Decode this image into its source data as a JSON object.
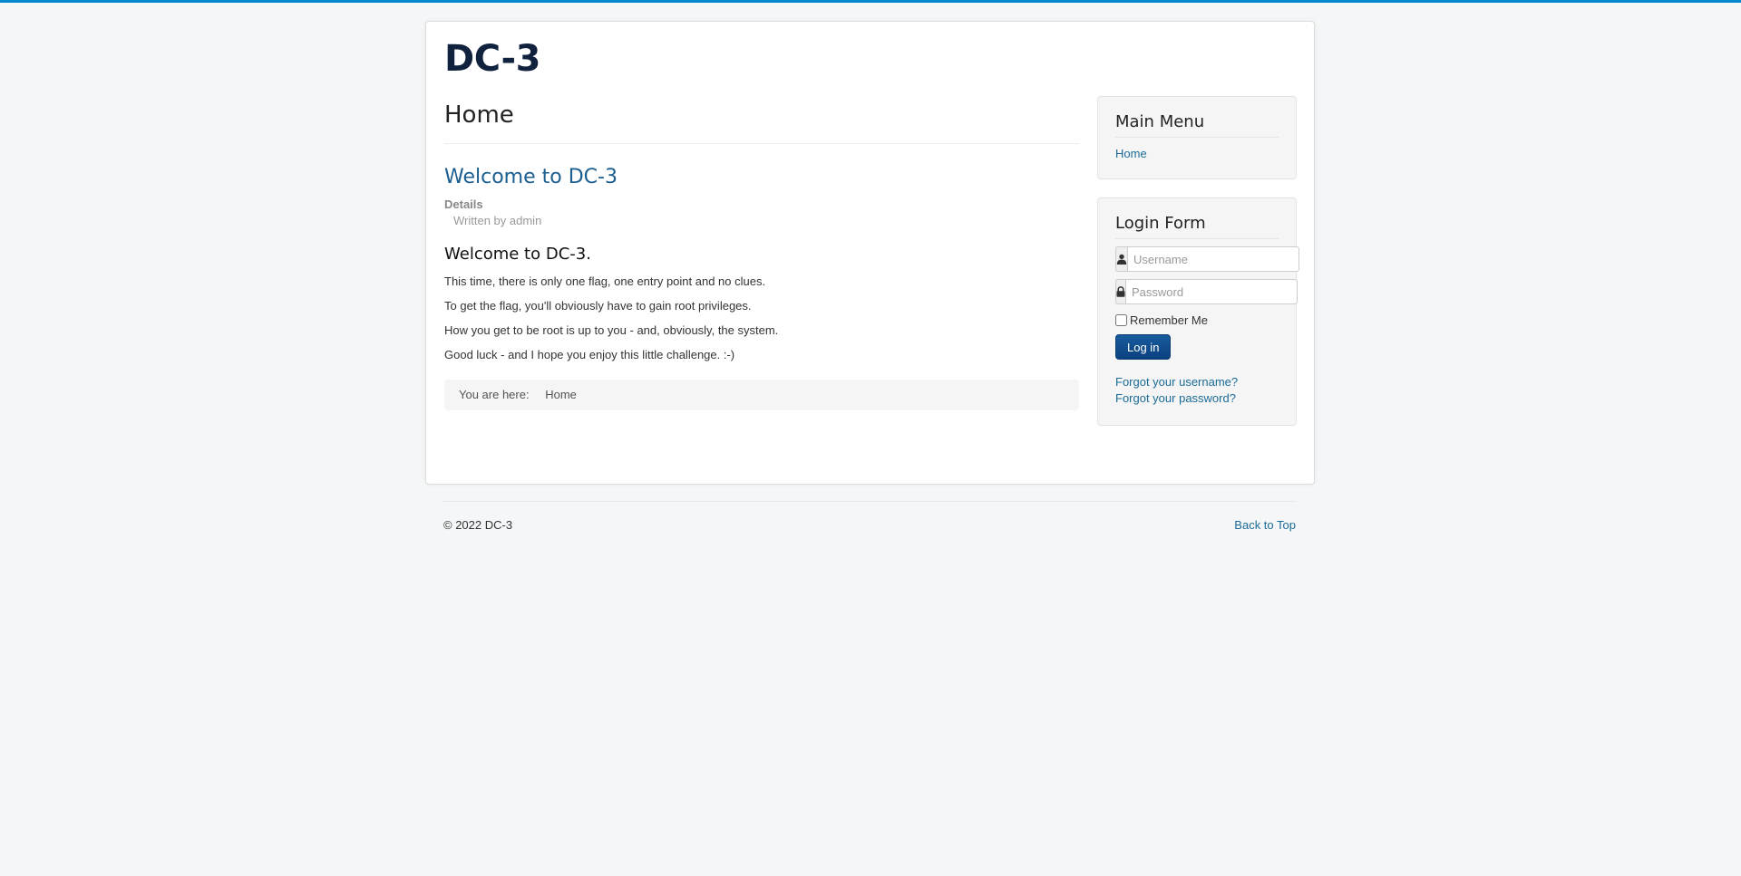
{
  "site": {
    "brand": "DC-3"
  },
  "page": {
    "title": "Home"
  },
  "article": {
    "title": "Welcome to DC-3",
    "details_label": "Details",
    "written_by": "Written by admin",
    "heading": "Welcome to DC-3.",
    "paragraphs": [
      "This time, there is only one flag, one entry point and no clues.",
      "To get the flag, you'll obviously have to gain root privileges.",
      "How you get to be root is up to you - and, obviously, the system.",
      "Good luck - and I hope you enjoy this little challenge.  :-)"
    ]
  },
  "breadcrumb": {
    "prefix": "You are here:",
    "current": "Home"
  },
  "main_menu": {
    "title": "Main Menu",
    "items": [
      {
        "label": "Home"
      }
    ]
  },
  "login_form": {
    "title": "Login Form",
    "username_placeholder": "Username",
    "password_placeholder": "Password",
    "remember_label": "Remember Me",
    "remember_checked": false,
    "login_button": "Log in",
    "forgot_username": "Forgot your username?",
    "forgot_password": "Forgot your password?",
    "icons": {
      "username": "user-icon",
      "password": "lock-icon"
    }
  },
  "footer": {
    "copyright": "© 2022 DC-3",
    "back_to_top": "Back to Top"
  },
  "colors": {
    "accent_bar": "#0088cc",
    "link": "#1b6b98",
    "button": "#0c4a8a",
    "background": "#f4f6f7"
  }
}
